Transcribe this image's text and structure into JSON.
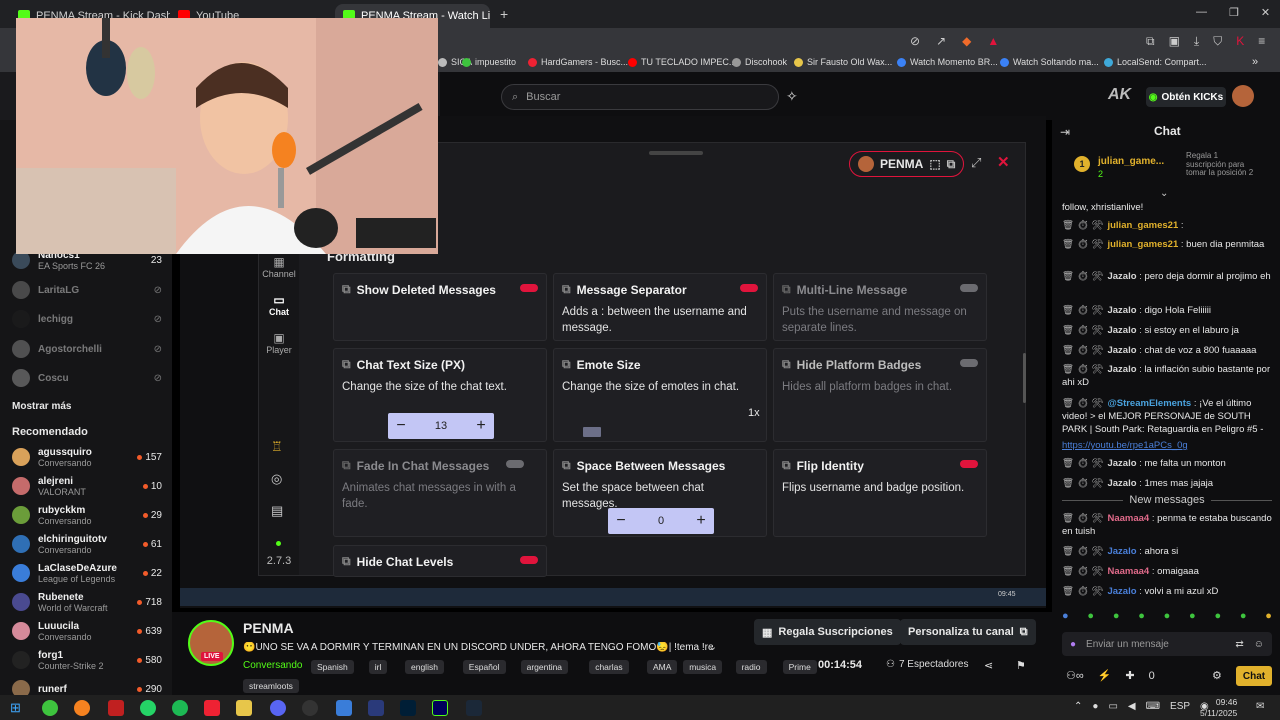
{
  "browser": {
    "tabs": [
      {
        "label": "PENMA Stream - Kick Dashboard",
        "color": "#53fc18"
      },
      {
        "label": "YouTube",
        "color": "#ff0000"
      },
      {
        "label": "PENMA Stream - Watch Live ...",
        "color": "#53fc18"
      }
    ],
    "bookmarks": [
      {
        "label": "SICA",
        "color": "#bbbbbb"
      },
      {
        "label": "impuestito",
        "color": "#3ec43e"
      },
      {
        "label": "HardGamers - Busc...",
        "color": "#e23"
      },
      {
        "label": "TU TECLADO IMPEC...",
        "color": "#ff0000"
      },
      {
        "label": "Discohook",
        "color": "#999"
      },
      {
        "label": "Sir Fausto Old Wax...",
        "color": "#e7c64a"
      },
      {
        "label": "Watch Momento BR...",
        "color": "#3b82f6"
      },
      {
        "label": "Watch Soltando ma...",
        "color": "#3b82f6"
      },
      {
        "label": "LocalSend: Compart...",
        "color": "#3fa9d9"
      }
    ]
  },
  "topbar": {
    "search_placeholder": "Buscar",
    "get_kicks": "Obtén KICKs"
  },
  "sidebar": {
    "top_channels": [
      {
        "name": "Nanocs1",
        "game": "EA Sports FC 26",
        "viewers": "23"
      },
      {
        "name": "LaritaLG",
        "game": "",
        "viewers": ""
      },
      {
        "name": "lechigg",
        "game": "",
        "viewers": ""
      },
      {
        "name": "Agostorchelli",
        "game": "",
        "viewers": ""
      },
      {
        "name": "Coscu",
        "game": "",
        "viewers": ""
      }
    ],
    "show_more": "Mostrar más",
    "recommended_title": "Recomendado",
    "recommended": [
      {
        "name": "agussquiro",
        "game": "Conversando",
        "viewers": "157",
        "color": "#d9a15a"
      },
      {
        "name": "alejreni",
        "game": "VALORANT",
        "viewers": "10",
        "color": "#c56b6b"
      },
      {
        "name": "rubyckkm",
        "game": "Conversando",
        "viewers": "29",
        "color": "#6b9d3a"
      },
      {
        "name": "elchiringuitotv",
        "game": "Conversando",
        "viewers": "61",
        "color": "#2f6fb5"
      },
      {
        "name": "LaClaseDeAzure",
        "game": "League of Legends",
        "viewers": "22",
        "color": "#3a7dd9"
      },
      {
        "name": "Rubenete",
        "game": "World of Warcraft",
        "viewers": "718",
        "color": "#4a4a90"
      },
      {
        "name": "Luuucila",
        "game": "Conversando",
        "viewers": "639",
        "color": "#d58a9a"
      },
      {
        "name": "forg1",
        "game": "Counter-Strike 2",
        "viewers": "580",
        "color": "#222222"
      },
      {
        "name": "runerf",
        "game": "",
        "viewers": "290",
        "color": "#8a6a4a"
      }
    ]
  },
  "popout": {
    "nav": [
      {
        "label": "Channel"
      },
      {
        "label": "Chat"
      },
      {
        "label": "Player"
      }
    ],
    "version": "2.7.3",
    "channel_badge": "PENMA",
    "section_title": "Formatting",
    "cards": [
      {
        "title": "Show Deleted Messages",
        "desc": "",
        "toggle": "on",
        "dim": false
      },
      {
        "title": "Message Separator",
        "desc": "Adds a : between the username and message.",
        "toggle": "on",
        "dim": false
      },
      {
        "title": "Multi-Line Message",
        "desc": "Puts the username and message on separate lines.",
        "toggle": "off",
        "dim": true
      },
      {
        "title": "Chat Text Size (PX)",
        "desc": "Change the size of the chat text.",
        "toggle": "",
        "dim": false
      },
      {
        "title": "Emote Size",
        "desc": "Change the size of emotes in chat.",
        "toggle": "",
        "dim": false
      },
      {
        "title": "Hide Platform Badges",
        "desc": "Hides all platform badges in chat.",
        "toggle": "off",
        "dim": true
      },
      {
        "title": "Fade In Chat Messages",
        "desc": "Animates chat messages in with a fade.",
        "toggle": "off",
        "dim": true
      },
      {
        "title": "Space Between Messages",
        "desc": "Set the space between chat messages.",
        "toggle": "",
        "dim": false
      },
      {
        "title": "Flip Identity",
        "desc": "Flips username and badge position.",
        "toggle": "on",
        "dim": false
      },
      {
        "title": "Hide Chat Levels",
        "desc": "",
        "toggle": "on",
        "dim": false
      }
    ],
    "text_size_value": "13",
    "emote_size_value": "1x",
    "emote_size_level": 0.12,
    "space_value": "0",
    "taskbar_clock": "09:45"
  },
  "chat": {
    "title": "Chat",
    "pinned_user": "julian_game...",
    "pinned_count": "2",
    "pinned_note": "Regala 1 suscripción para tomar la posición 2",
    "messages": [
      {
        "user": "",
        "text": "follow, xhristianlive!",
        "color": "#e8e8e8"
      },
      {
        "user": "julian_games21",
        "text": "",
        "color": "#e1b12c"
      },
      {
        "user": "julian_games21",
        "text": "buen dia penmitaa",
        "color": "#e1b12c"
      },
      {
        "user": "Jazalo",
        "text": "pero deja dormir al projimo eh",
        "color": "#d8d8d8"
      },
      {
        "user": "Jazalo",
        "text": "digo Hola Feliiiii",
        "color": "#d8d8d8"
      },
      {
        "user": "Jazalo",
        "text": "si estoy en el laburo ja",
        "color": "#d8d8d8"
      },
      {
        "user": "Jazalo",
        "text": "chat de voz a 800 fuaaaaa",
        "color": "#d8d8d8"
      },
      {
        "user": "Jazalo",
        "text": "la inflación subio bastante por ahi xD",
        "color": "#d8d8d8"
      },
      {
        "user": "@StreamElements",
        "text": "¡Ve el último video! > el MEJOR PERSONAJE de SOUTH PARK | South Park: Retaguardia en Peligro #5 -",
        "color": "#4aa3df"
      },
      {
        "user": "",
        "text": "https://youtu.be/rpe1aPCs_0g",
        "color": "#4a7fd9"
      },
      {
        "user": "Jazalo",
        "text": "me falta un monton",
        "color": "#d8d8d8"
      },
      {
        "user": "Jazalo",
        "text": "1mes mas jajaja",
        "color": "#d8d8d8"
      }
    ],
    "new_messages": "New messages",
    "new_msgs": [
      {
        "user": "Naamaa4",
        "text": "penma te estaba buscando en tuish",
        "color": "#e06a8a"
      },
      {
        "user": "Jazalo",
        "text": "ahora si",
        "color": "#4a7fd9"
      },
      {
        "user": "Naamaa4",
        "text": "omaigaaa",
        "color": "#e06a8a"
      },
      {
        "user": "Jazalo",
        "text": "volvi a mi azul xD",
        "color": "#4a7fd9"
      }
    ],
    "input_placeholder": "Enviar un mensaje",
    "points": "0",
    "send_label": "Chat"
  },
  "stream": {
    "channel": "PENMA",
    "title": "😶UNO SE VA A DORMIR Y TERMINAN EN UN DISCORD UNDER, AHORA TENGO FOMO😓| !tema !re...",
    "category": "Conversando",
    "tags": [
      "Spanish",
      "irl",
      "english",
      "Español",
      "argentina",
      "charlas",
      "AMA",
      "musica",
      "radio",
      "Prime"
    ],
    "tag2": "streamloots",
    "subs_button": "Regala Suscripciones",
    "customize_button": "Personaliza tu canal",
    "uptime": "00:14:54",
    "viewers": "7 Espectadores"
  },
  "taskbar": {
    "lang": "ESP",
    "time": "09:46",
    "date": "5/11/2025"
  }
}
